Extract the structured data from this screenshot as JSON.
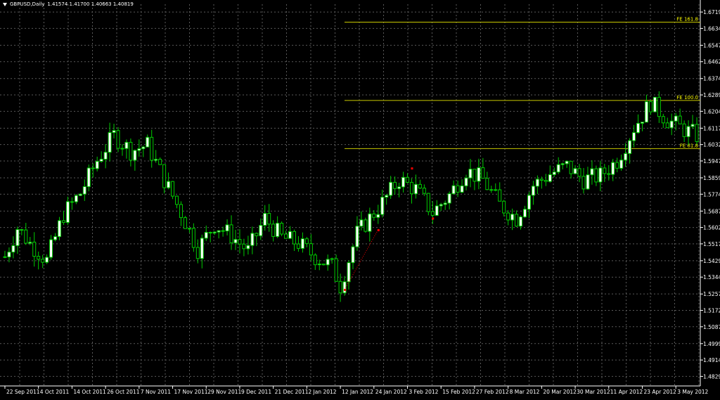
{
  "header": {
    "symbol": "GBPUSD,Daily",
    "ohlc": "1.41574 1.41700 1.40663 1.40819"
  },
  "colors": {
    "background": "#000000",
    "grid": "#5a5a5a",
    "bull_body": "#ffffff",
    "bear_body": "#ffffff",
    "wick": "#00cc00",
    "fib_line": "#c8c800",
    "fib_text": "#ffff00",
    "axis_text": "#ffffff",
    "marker": "#ff0000"
  },
  "chart_data": {
    "type": "candlestick",
    "ylim": [
      1.478,
      1.676
    ],
    "y_ticks": [
      {
        "value": 1.67195,
        "label": "1.67195"
      },
      {
        "value": 1.66345,
        "label": "1.66345"
      },
      {
        "value": 1.6547,
        "label": "1.65470"
      },
      {
        "value": 1.6462,
        "label": "1.64620"
      },
      {
        "value": 1.63745,
        "label": "1.63745"
      },
      {
        "value": 1.62895,
        "label": "1.62895"
      },
      {
        "value": 1.62045,
        "label": "1.62045"
      },
      {
        "value": 1.6117,
        "label": "1.61170"
      },
      {
        "value": 1.6032,
        "label": "1.60320"
      },
      {
        "value": 1.5947,
        "label": "1.59470"
      },
      {
        "value": 1.58595,
        "label": "1.58595"
      },
      {
        "value": 1.57745,
        "label": "1.57745"
      },
      {
        "value": 1.5687,
        "label": "1.56870"
      },
      {
        "value": 1.5602,
        "label": "1.56020"
      },
      {
        "value": 1.5517,
        "label": "1.55170"
      },
      {
        "value": 1.54295,
        "label": "1.54295"
      },
      {
        "value": 1.53445,
        "label": "1.53445"
      },
      {
        "value": 1.5257,
        "label": "1.52570"
      },
      {
        "value": 1.5172,
        "label": "1.51720"
      },
      {
        "value": 1.5087,
        "label": "1.50870"
      },
      {
        "value": 1.49995,
        "label": "1.49995"
      },
      {
        "value": 1.49145,
        "label": "1.49145"
      },
      {
        "value": 1.48295,
        "label": "1.48295"
      }
    ],
    "x_labels": [
      {
        "label": "22 Sep 2011",
        "index": 0
      },
      {
        "label": "4 Oct 2011",
        "index": 8
      },
      {
        "label": "14 Oct 2011",
        "index": 16
      },
      {
        "label": "26 Oct 2011",
        "index": 24
      },
      {
        "label": "7 Nov 2011",
        "index": 32
      },
      {
        "label": "17 Nov 2011",
        "index": 40
      },
      {
        "label": "29 Nov 2011",
        "index": 48
      },
      {
        "label": "9 Dec 2011",
        "index": 56
      },
      {
        "label": "21 Dec 2011",
        "index": 64
      },
      {
        "label": "2 Jan 2012",
        "index": 72
      },
      {
        "label": "12 Jan 2012",
        "index": 80
      },
      {
        "label": "24 Jan 2012",
        "index": 88
      },
      {
        "label": "3 Feb 2012",
        "index": 96
      },
      {
        "label": "15 Feb 2012",
        "index": 104
      },
      {
        "label": "27 Feb 2012",
        "index": 112
      },
      {
        "label": "8 Mar 2012",
        "index": 120
      },
      {
        "label": "20 Mar 2012",
        "index": 128
      },
      {
        "label": "30 Mar 2012",
        "index": 136
      },
      {
        "label": "11 Apr 2012",
        "index": 144
      },
      {
        "label": "23 Apr 2012",
        "index": 152
      },
      {
        "label": "3 May 2012",
        "index": 160
      }
    ],
    "anchors": [
      [
        0,
        1.545
      ],
      [
        3,
        1.56
      ],
      [
        6,
        1.552
      ],
      [
        10,
        1.543
      ],
      [
        14,
        1.567
      ],
      [
        18,
        1.578
      ],
      [
        22,
        1.595
      ],
      [
        26,
        1.608
      ],
      [
        30,
        1.6
      ],
      [
        34,
        1.603
      ],
      [
        38,
        1.585
      ],
      [
        42,
        1.568
      ],
      [
        46,
        1.549
      ],
      [
        50,
        1.562
      ],
      [
        54,
        1.556
      ],
      [
        58,
        1.548
      ],
      [
        62,
        1.565
      ],
      [
        66,
        1.555
      ],
      [
        70,
        1.552
      ],
      [
        74,
        1.545
      ],
      [
        78,
        1.54
      ],
      [
        80,
        1.53
      ],
      [
        84,
        1.557
      ],
      [
        90,
        1.573
      ],
      [
        94,
        1.585
      ],
      [
        98,
        1.58
      ],
      [
        102,
        1.568
      ],
      [
        106,
        1.577
      ],
      [
        110,
        1.59
      ],
      [
        114,
        1.585
      ],
      [
        118,
        1.572
      ],
      [
        122,
        1.565
      ],
      [
        126,
        1.582
      ],
      [
        130,
        1.588
      ],
      [
        134,
        1.592
      ],
      [
        138,
        1.585
      ],
      [
        142,
        1.587
      ],
      [
        146,
        1.595
      ],
      [
        150,
        1.612
      ],
      [
        154,
        1.625
      ],
      [
        158,
        1.616
      ],
      [
        162,
        1.611
      ],
      [
        165,
        1.608
      ]
    ],
    "candle_count": 166,
    "fib_levels": [
      {
        "label": "FE 161.8",
        "value": 1.6667
      },
      {
        "label": "FE 100.0",
        "value": 1.6261
      },
      {
        "label": "FE 61.8",
        "value": 1.6011
      }
    ]
  }
}
